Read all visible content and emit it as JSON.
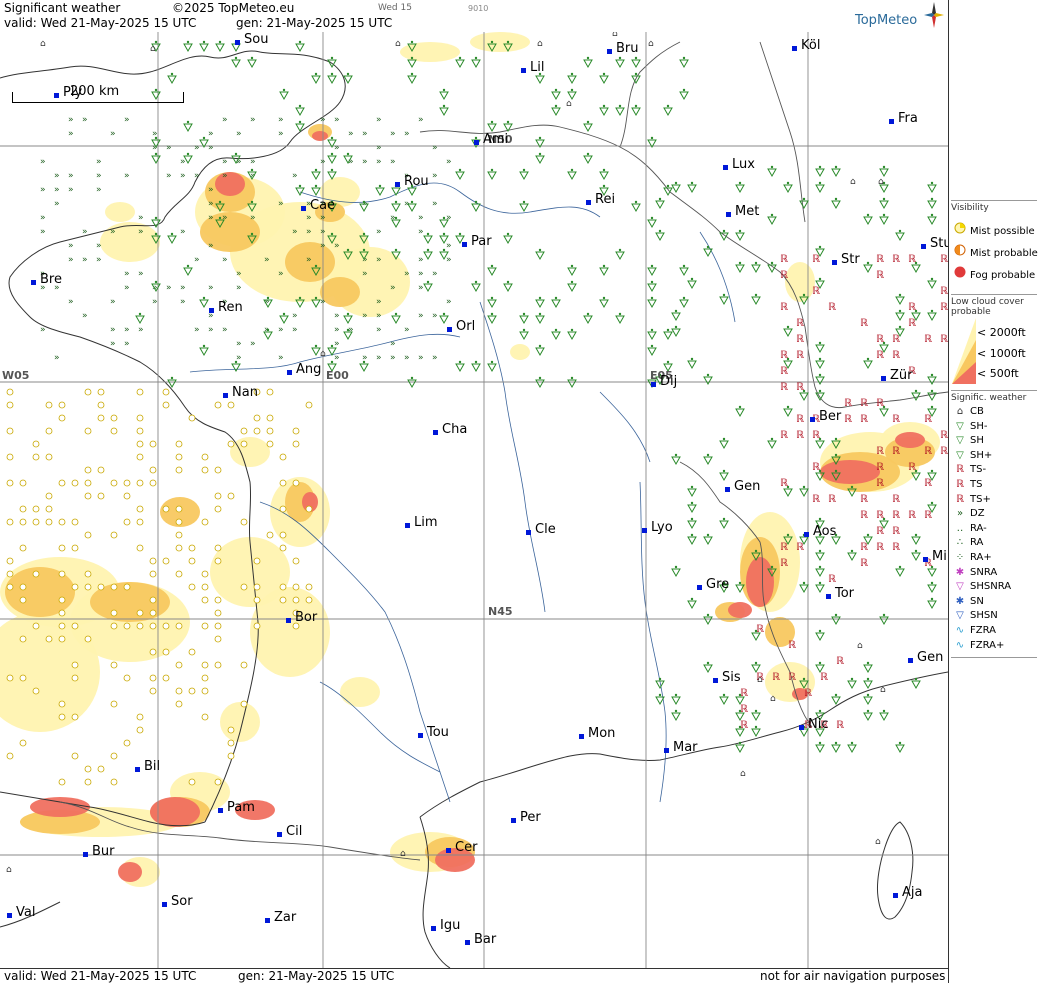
{
  "header": {
    "title": "Significant weather",
    "copyright": "©2025 TopMeteo.eu",
    "run_day": "Wed 15",
    "code": "9010",
    "valid": "valid:  Wed  21-May-2025  15 UTC",
    "gen": "gen: 21-May-2025 15 UTC",
    "logo": "TopMeteo"
  },
  "footer": {
    "valid": "valid:  Wed  21-May-2025  15 UTC",
    "gen": "gen:  21-May-2025  15 UTC",
    "note": "not for air navigation purposes"
  },
  "scale_label": "200 km",
  "grid_labels": {
    "n50": "N50",
    "n45": "N45",
    "w05": "W05",
    "e00": "E00",
    "e05": "E05"
  },
  "cities": [
    {
      "name": "Sou"
    },
    {
      "name": "Ply"
    },
    {
      "name": "Lil"
    },
    {
      "name": "Bru"
    },
    {
      "name": "Köl"
    },
    {
      "name": "Ami"
    },
    {
      "name": "Fra"
    },
    {
      "name": "Rou"
    },
    {
      "name": "Lux"
    },
    {
      "name": "Cae"
    },
    {
      "name": "Rei"
    },
    {
      "name": "Met"
    },
    {
      "name": "Bre"
    },
    {
      "name": "Par"
    },
    {
      "name": "Str"
    },
    {
      "name": "Stu"
    },
    {
      "name": "Ren"
    },
    {
      "name": "Orl"
    },
    {
      "name": "Ang"
    },
    {
      "name": "Nan"
    },
    {
      "name": "Dij"
    },
    {
      "name": "Zür"
    },
    {
      "name": "Cha"
    },
    {
      "name": "Ber"
    },
    {
      "name": "Gen"
    },
    {
      "name": "Lim"
    },
    {
      "name": "Cle"
    },
    {
      "name": "Lyo"
    },
    {
      "name": "Aos"
    },
    {
      "name": "Mil"
    },
    {
      "name": "Gre"
    },
    {
      "name": "Tor"
    },
    {
      "name": "Bor"
    },
    {
      "name": "Gen"
    },
    {
      "name": "Sis"
    },
    {
      "name": "Tou"
    },
    {
      "name": "Mon"
    },
    {
      "name": "Nic"
    },
    {
      "name": "Mar"
    },
    {
      "name": "Bil"
    },
    {
      "name": "Pam"
    },
    {
      "name": "Per"
    },
    {
      "name": "Cil"
    },
    {
      "name": "Cer"
    },
    {
      "name": "Bur"
    },
    {
      "name": "Sor"
    },
    {
      "name": "Val"
    },
    {
      "name": "Zar"
    },
    {
      "name": "Aja"
    },
    {
      "name": "Igu"
    },
    {
      "name": "Bar"
    }
  ],
  "legend": {
    "visibility_title": "Visibility",
    "visibility": [
      {
        "label": "Mist possible",
        "color": "#f5d800"
      },
      {
        "label": "Mist probable",
        "color": "#f08a1c"
      },
      {
        "label": "Fog probable",
        "color": "#e03a3a"
      }
    ],
    "cloud_title": "Low cloud cover probable",
    "cloud": [
      {
        "label": "< 2000ft",
        "color": "#fff3b0"
      },
      {
        "label": "< 1000ft",
        "color": "#f8c860"
      },
      {
        "label": "<  500ft",
        "color": "#f07060"
      }
    ],
    "weather_title": "Signific. weather",
    "weather": [
      {
        "label": "CB",
        "symbol": "cb-icon"
      },
      {
        "label": "SH-",
        "symbol": "shower-light-icon"
      },
      {
        "label": "SH",
        "symbol": "shower-icon"
      },
      {
        "label": "SH+",
        "symbol": "shower-heavy-icon"
      },
      {
        "label": "TS-",
        "symbol": "thunderstorm-light-icon"
      },
      {
        "label": "TS",
        "symbol": "thunderstorm-icon"
      },
      {
        "label": "TS+",
        "symbol": "thunderstorm-heavy-icon"
      },
      {
        "label": "DZ",
        "symbol": "drizzle-icon"
      },
      {
        "label": "RA-",
        "symbol": "rain-light-icon"
      },
      {
        "label": "RA",
        "symbol": "rain-icon"
      },
      {
        "label": "RA+",
        "symbol": "rain-heavy-icon"
      },
      {
        "label": "SNRA",
        "symbol": "snow-rain-icon"
      },
      {
        "label": "SHSNRA",
        "symbol": "snow-rain-shower-icon"
      },
      {
        "label": "SN",
        "symbol": "snow-icon"
      },
      {
        "label": "SHSN",
        "symbol": "snow-shower-icon"
      },
      {
        "label": "FZRA",
        "symbol": "freezing-rain-icon"
      },
      {
        "label": "FZRA+",
        "symbol": "freezing-rain-heavy-icon"
      }
    ]
  },
  "colors": {
    "cloud2000": "#fff3b0",
    "cloud1000": "#f8c860",
    "cloud500": "#f07060",
    "shower": "#2a8a2a",
    "thunder": "#b01020",
    "drizzle": "#1f5f1f",
    "city": "#0018d8",
    "coast": "#3a3a3a",
    "river": "#1a4a8a"
  }
}
